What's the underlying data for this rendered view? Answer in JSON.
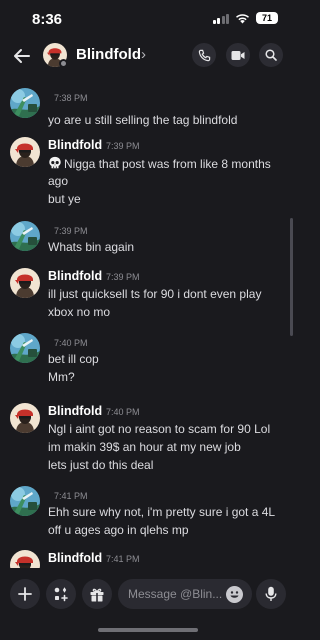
{
  "status_bar": {
    "time": "8:36",
    "battery": "71"
  },
  "header": {
    "name": "Blindfold",
    "chevron": "›"
  },
  "messages": [
    {
      "author": "",
      "time": "7:38 PM",
      "lines": [
        "yo are u still selling the tag blindfold"
      ]
    },
    {
      "author": "Blindfold",
      "time": "7:39 PM",
      "lines": [
        "Nigga that post was from like 8 months",
        "ago",
        "but ye"
      ]
    },
    {
      "author": "",
      "time": "7:39 PM",
      "lines": [
        "Whats bin again"
      ]
    },
    {
      "author": "Blindfold",
      "time": "7:39 PM",
      "lines": [
        "ill just quicksell ts for 90 i dont even play",
        "xbox no mo"
      ]
    },
    {
      "author": "",
      "time": "7:40 PM",
      "lines": [
        "bet ill cop",
        "Mm?"
      ]
    },
    {
      "author": "Blindfold",
      "time": "7:40 PM",
      "lines": [
        "Ngl i aint got no reason to scam for 90 Lol",
        "im makin 39$ an hour at my new job",
        "lets just do this deal"
      ]
    },
    {
      "author": "",
      "time": "7:41 PM",
      "lines": [
        "Ehh sure why not, i'm pretty sure i got a 4L",
        "off u ages ago in qlehs mp"
      ]
    },
    {
      "author": "Blindfold",
      "time": "7:41 PM",
      "lines": []
    }
  ],
  "composer": {
    "placeholder": "Message @Blin..."
  },
  "colors": {
    "background": "#1a1a1e",
    "button_bg": "#2a2a31",
    "timestamp": "#8d8d93",
    "text": "#dcdce0"
  }
}
